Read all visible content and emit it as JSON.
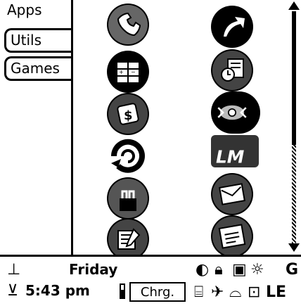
{
  "tabs": [
    "Apps",
    "Utils",
    "Games"
  ],
  "status": {
    "day": "Friday",
    "time": "5:43 pm",
    "charge": "Chrg.",
    "edge_left": "LE",
    "edge_right": "G"
  },
  "icons_left": [
    "phone-icon",
    "calculator-icon",
    "dollar-icon",
    "sync-icon",
    "hotsync-icon",
    "notepad-icon"
  ],
  "icons_right": [
    "navigation-arrow-icon",
    "alarm-clock-icon",
    "network-icon",
    "lm-icon",
    "mail-icon",
    "contacts-icon"
  ]
}
